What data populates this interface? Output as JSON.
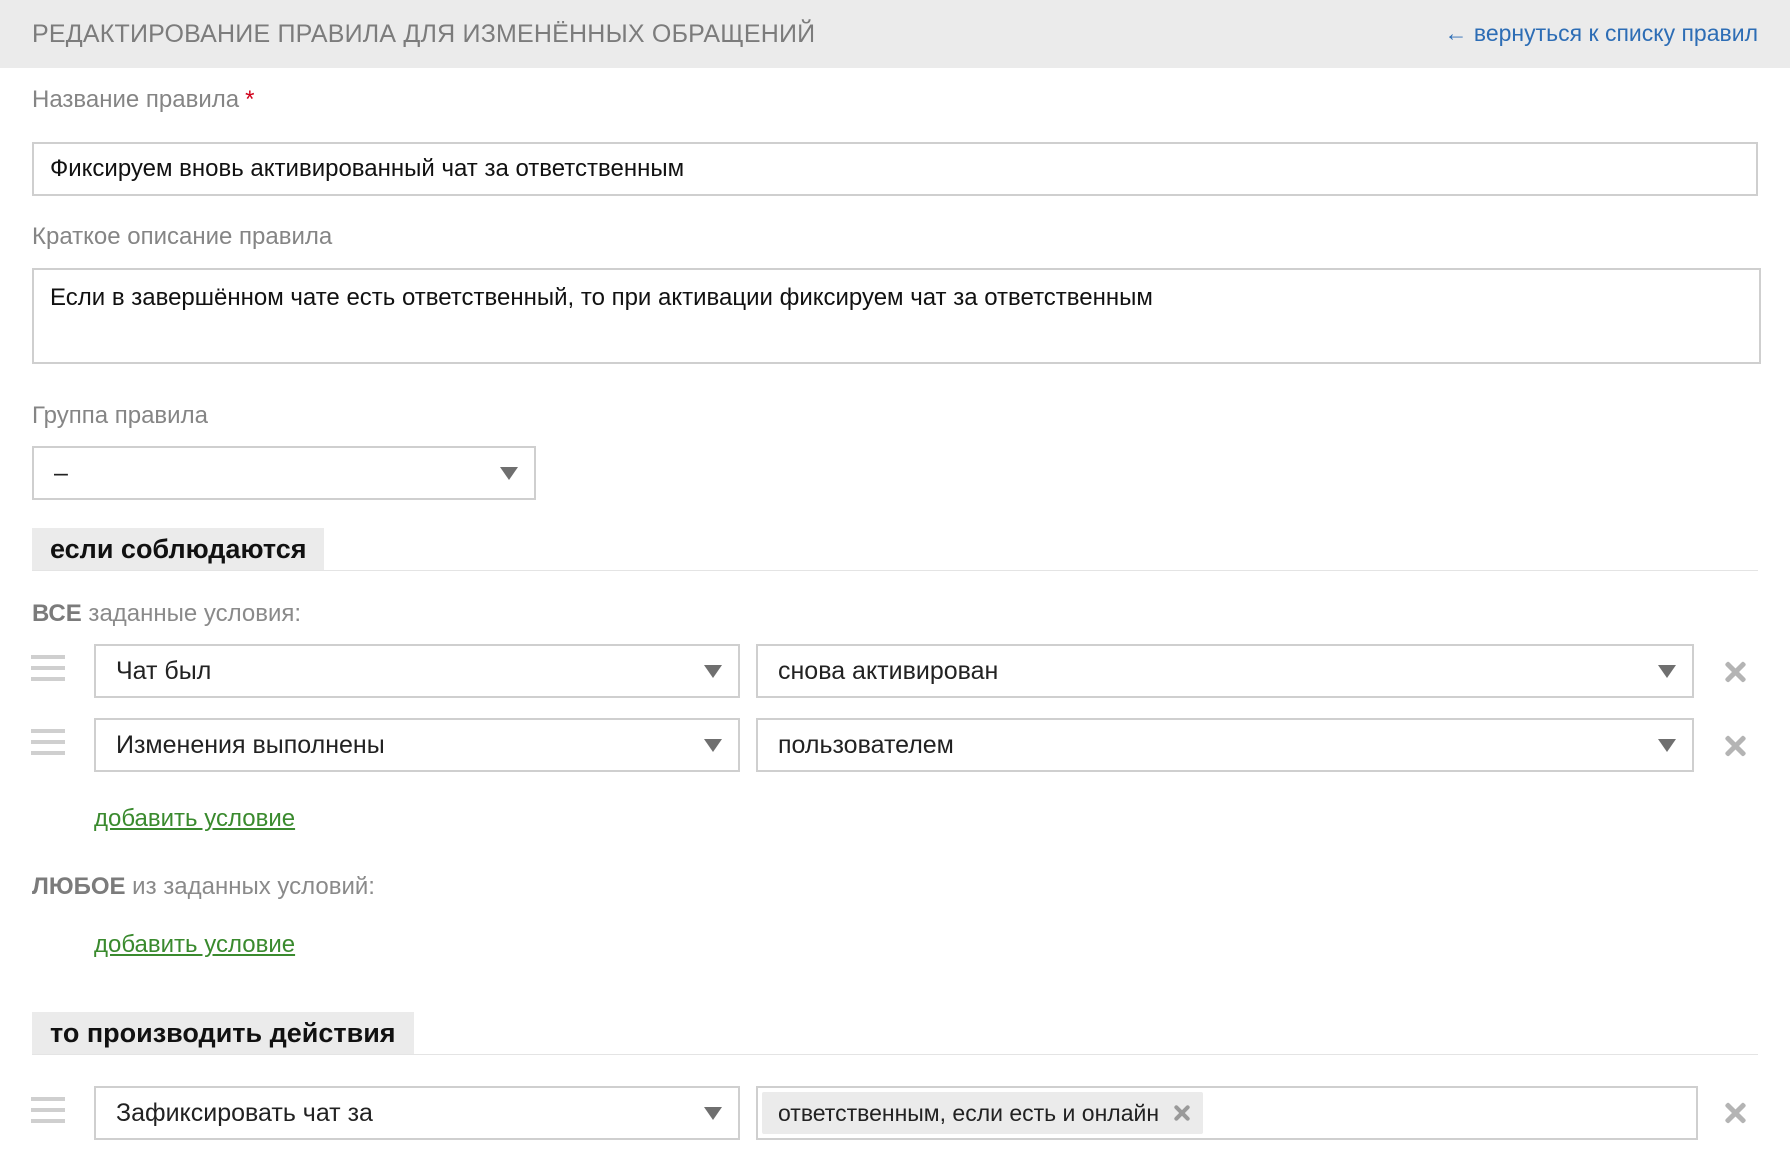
{
  "header": {
    "title": "РЕДАКТИРОВАНИЕ ПРАВИЛА ДЛЯ ИЗМЕНЁННЫХ ОБРАЩЕНИЙ",
    "back_link": "← вернуться к списку правил"
  },
  "form": {
    "name_label": "Название правила",
    "required_mark": "*",
    "name_value": "Фиксируем вновь активированный чат за ответственным",
    "description_label": "Краткое описание правила",
    "description_value": "Если в завершённом чате есть ответственный, то при активации фиксируем чат за ответственным",
    "group_label": "Группа правила",
    "group_value": "–"
  },
  "conditions": {
    "section_title": "если соблюдаются",
    "all_label_strong": "ВСЕ",
    "all_label_rest": " заданные условия:",
    "all_rows": [
      {
        "field": "Чат был",
        "value": "снова активирован"
      },
      {
        "field": "Изменения выполнены",
        "value": "пользователем"
      }
    ],
    "add_condition": "добавить условие",
    "any_label_strong": "ЛЮБОЕ",
    "any_label_rest": " из заданных условий:"
  },
  "actions": {
    "section_title": "то производить действия",
    "rows": [
      {
        "field": "Зафиксировать чат за",
        "tags": [
          "ответственным, если есть и онлайн"
        ]
      }
    ]
  },
  "colors": {
    "link_blue": "#2d6db5",
    "link_green": "#3a8a2e",
    "required_red": "#d0021b",
    "header_bg": "#ebebeb"
  },
  "icons": {
    "back": "left-arrow",
    "select": "caret-down-icon",
    "remove": "x-icon",
    "drag": "drag-handle-icon"
  }
}
